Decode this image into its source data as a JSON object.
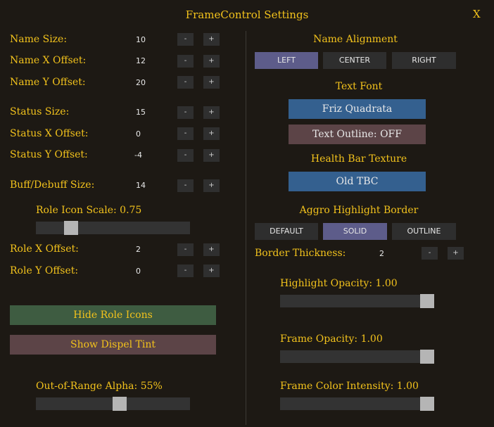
{
  "window": {
    "title": "FrameControl Settings",
    "close_label": "X"
  },
  "left": {
    "rows": [
      {
        "label": "Name Size:",
        "value": "10"
      },
      {
        "label": "Name X Offset:",
        "value": "12"
      },
      {
        "label": "Name Y Offset:",
        "value": "20"
      },
      {
        "label": "Status Size:",
        "value": "15"
      },
      {
        "label": "Status X Offset:",
        "value": "0"
      },
      {
        "label": "Status Y Offset:",
        "value": "-4"
      },
      {
        "label": "Buff/Debuff Size:",
        "value": "14"
      },
      {
        "label": "Role X Offset:",
        "value": "2"
      },
      {
        "label": "Role Y Offset:",
        "value": "0"
      }
    ],
    "minus_label": "-",
    "plus_label": "+",
    "role_icon_scale": {
      "label": "Role Icon Scale: 0.75",
      "fraction": 0.2
    },
    "hide_role_icons_label": "Hide Role Icons",
    "show_dispel_tint_label": "Show Dispel Tint",
    "out_of_range_alpha": {
      "label": "Out-of-Range Alpha: 55%",
      "fraction": 0.55
    }
  },
  "right": {
    "name_alignment": {
      "heading": "Name Alignment",
      "options": [
        "LEFT",
        "CENTER",
        "RIGHT"
      ],
      "selected": "LEFT"
    },
    "text_font": {
      "heading": "Text Font",
      "font_label": "Friz Quadrata",
      "outline_label": "Text Outline: OFF"
    },
    "health_bar_texture": {
      "heading": "Health Bar Texture",
      "texture_label": "Old TBC"
    },
    "aggro_border": {
      "heading": "Aggro Highlight Border",
      "options": [
        "DEFAULT",
        "SOLID",
        "OUTLINE"
      ],
      "selected": "SOLID"
    },
    "border_thickness": {
      "label": "Border Thickness:",
      "value": "2"
    },
    "highlight_opacity": {
      "label": "Highlight Opacity: 1.00",
      "fraction": 1.0
    },
    "frame_opacity": {
      "label": "Frame Opacity: 1.00",
      "fraction": 1.0
    },
    "frame_color_intensity": {
      "label": "Frame Color Intensity: 1.00",
      "fraction": 1.0
    }
  },
  "colors": {
    "label_gold": "#f2c21c",
    "background": "#1d1914",
    "selected_segment": "#5d5c8a",
    "blue_button": "#34608f",
    "green_button": "#3e5c41",
    "red_button": "#5c4447"
  }
}
